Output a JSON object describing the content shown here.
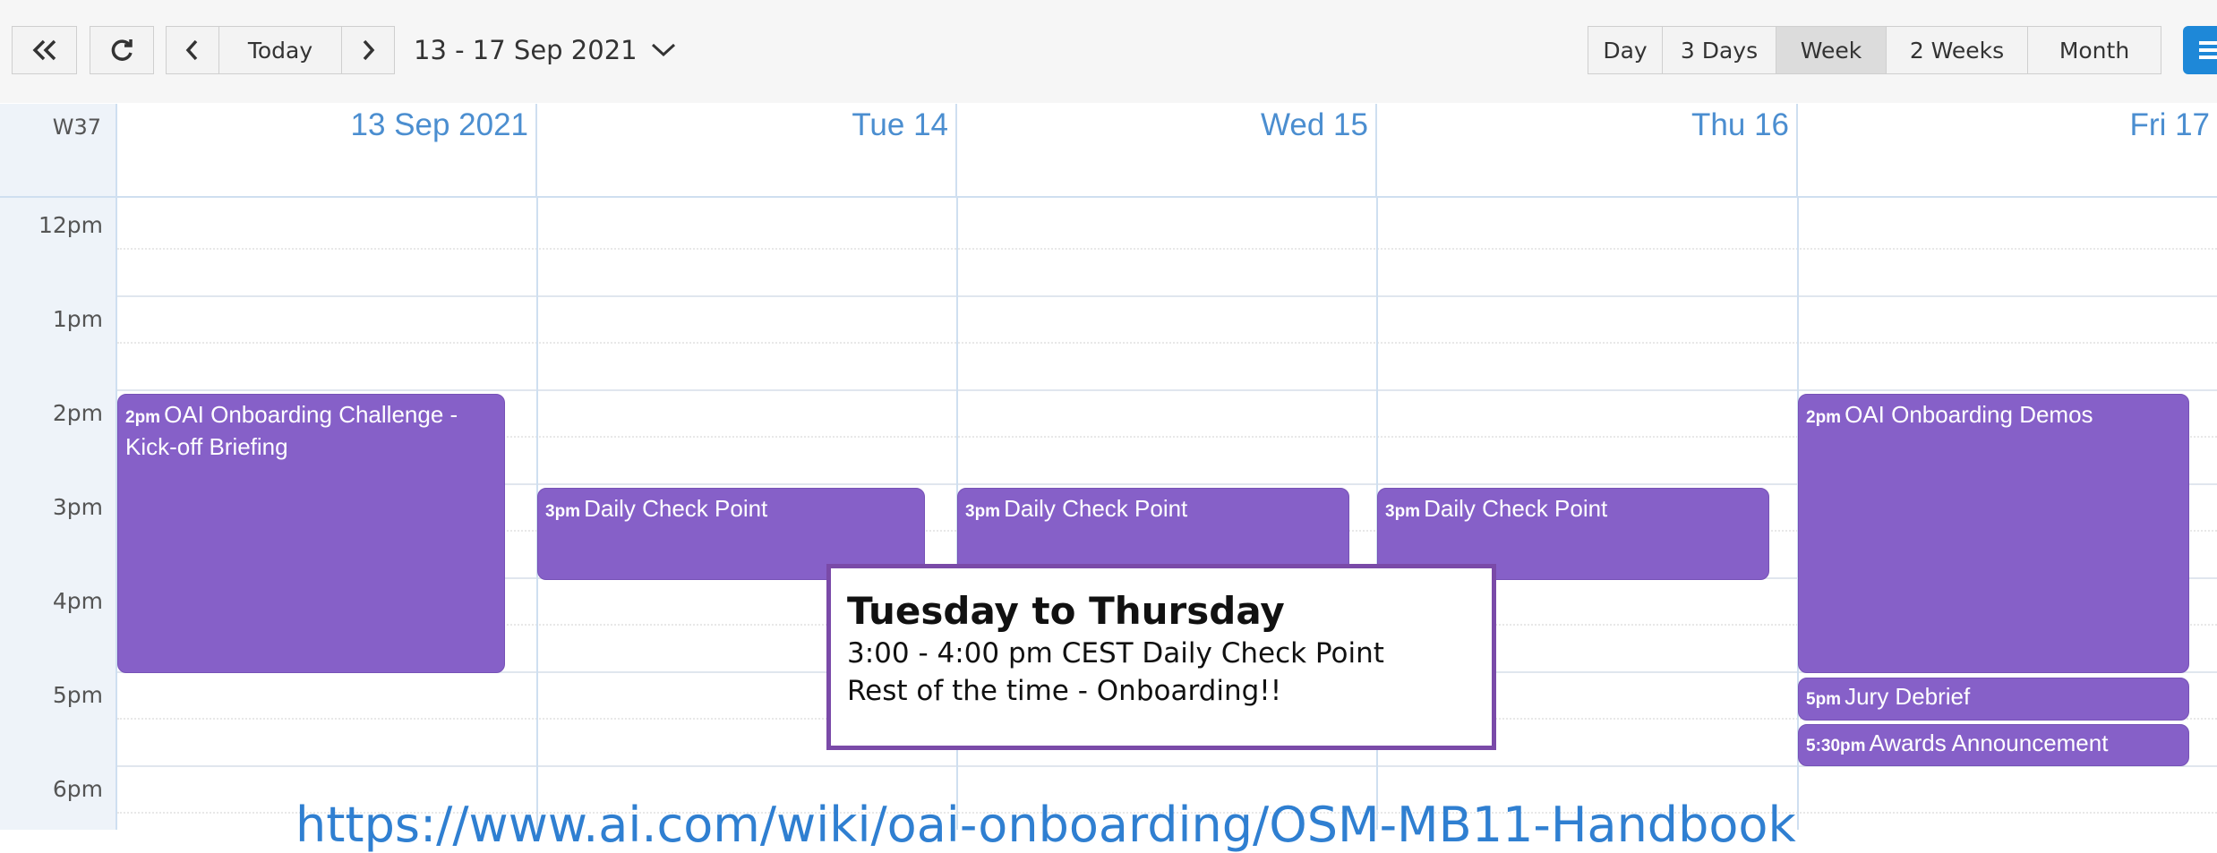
{
  "toolbar": {
    "range_label": "13 - 17 Sep 2021",
    "today_label": "Today",
    "views": [
      "Day",
      "3 Days",
      "Week",
      "2 Weeks",
      "Month"
    ],
    "active_view": "Week"
  },
  "header": {
    "week_label": "W37",
    "days": [
      "13 Sep 2021",
      "Tue 14",
      "Wed 15",
      "Thu 16",
      "Fri 17"
    ]
  },
  "hours": [
    "12pm",
    "1pm",
    "2pm",
    "3pm",
    "4pm",
    "5pm",
    "6pm"
  ],
  "events": [
    {
      "time": "2pm",
      "title": "OAI Onboarding Challenge - Kick-off Briefing"
    },
    {
      "time": "3pm",
      "title": "Daily Check Point"
    },
    {
      "time": "3pm",
      "title": "Daily Check Point"
    },
    {
      "time": "3pm",
      "title": "Daily Check Point"
    },
    {
      "time": "2pm",
      "title": "OAI Onboarding Demos"
    },
    {
      "time": "5pm",
      "title": "Jury Debrief"
    },
    {
      "time": "5:30pm",
      "title": "Awards Announcement"
    }
  ],
  "note": {
    "heading": "Tuesday to Thursday",
    "line1": "3:00 - 4:00 pm CEST Daily Check Point",
    "line2": "Rest of the time - Onboarding!!"
  },
  "url_text": "https://www.ai.com/wiki/oai-onboarding/OSM-MB11-Handbook",
  "colors": {
    "event": "#8660c8",
    "accent": "#4b8ed0",
    "note_border": "#7a4aa8"
  }
}
